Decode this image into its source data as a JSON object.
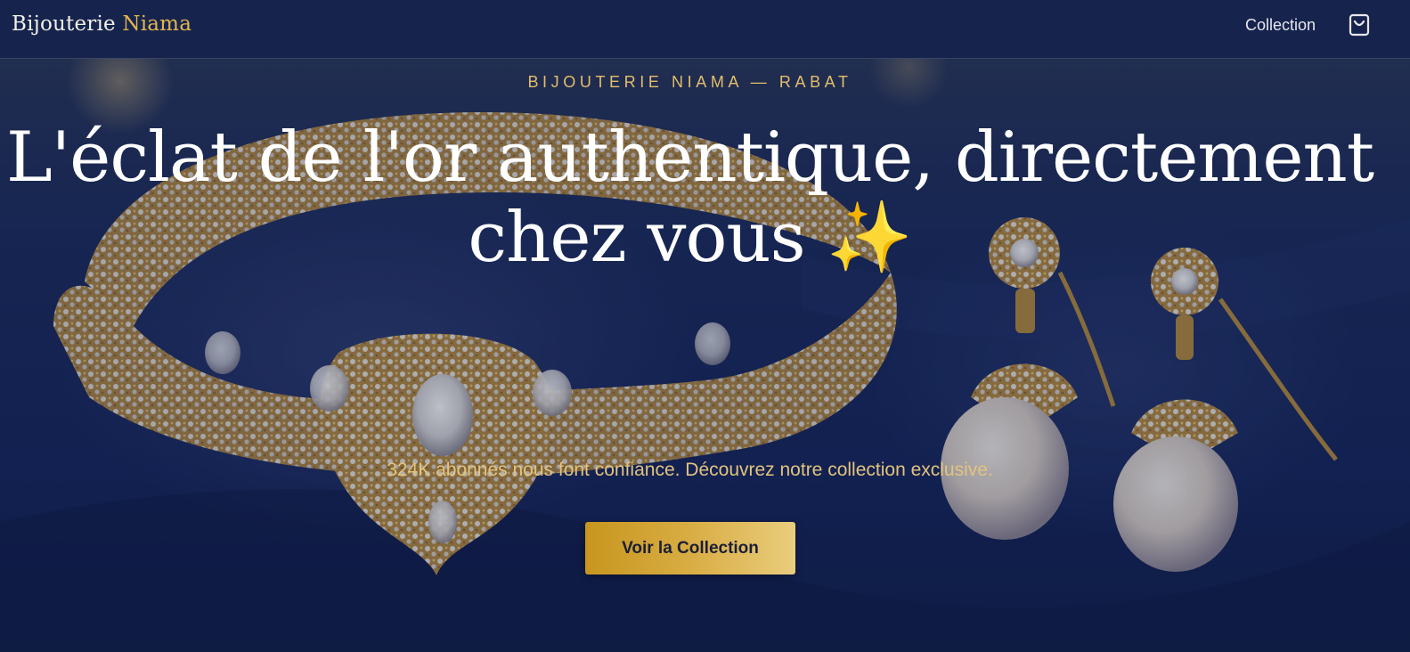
{
  "nav": {
    "brand_main": "Bijouterie",
    "brand_accent": "Niama",
    "link_collection": "Collection",
    "cart_icon": "shopping-bag-icon"
  },
  "hero": {
    "eyebrow": "BIJOUTERIE NIAMA — RABAT",
    "headline": "L'éclat de l'or authentique, directement chez vous ✨",
    "subtitle": "324K abonnés nous font confiance. Découvrez notre collection exclusive.",
    "cta_label": "Voir la Collection",
    "background_image": "gold-diamond-necklace-and-pearl-earrings-on-navy-velvet"
  },
  "colors": {
    "nav_bg": "#16244d",
    "gold_accent": "#e3b54e",
    "subtitle_gold": "#e3c37d",
    "cta_gradient_start": "#c8961e",
    "cta_gradient_end": "#e9cd7d"
  }
}
